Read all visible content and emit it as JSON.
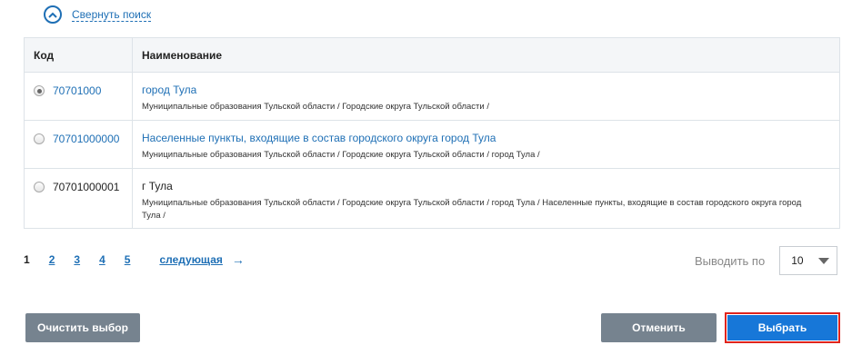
{
  "search": {
    "collapse_label": "Свернуть поиск"
  },
  "table": {
    "headers": {
      "code": "Код",
      "name": "Наименование"
    },
    "rows": [
      {
        "code": "70701000",
        "title": "город Тула",
        "path": "Муниципальные образования Тульской области / Городские округа Тульской области /",
        "selected": true
      },
      {
        "code": "70701000000",
        "title": "Населенные пункты, входящие в состав городского округа город Тула",
        "path": "Муниципальные образования Тульской области / Городские округа Тульской области / город Тула /",
        "selected": false
      },
      {
        "code": "70701000001",
        "title": "г Тула",
        "path": "Муниципальные образования Тульской области / Городские округа Тульской области / город Тула / Населенные пункты, входящие в состав городского округа город Тула /",
        "selected": false
      }
    ]
  },
  "pagination": {
    "pages": [
      "1",
      "2",
      "3",
      "4",
      "5"
    ],
    "current": "1",
    "next_label": "следующая"
  },
  "perpage": {
    "label": "Выводить по",
    "value": "10"
  },
  "buttons": {
    "clear": "Очистить выбор",
    "cancel": "Отменить",
    "select": "Выбрать"
  },
  "colors": {
    "link": "#1e6fb5",
    "primary": "#1777d8",
    "secondary": "#76838f",
    "highlight": "#e0241c"
  }
}
